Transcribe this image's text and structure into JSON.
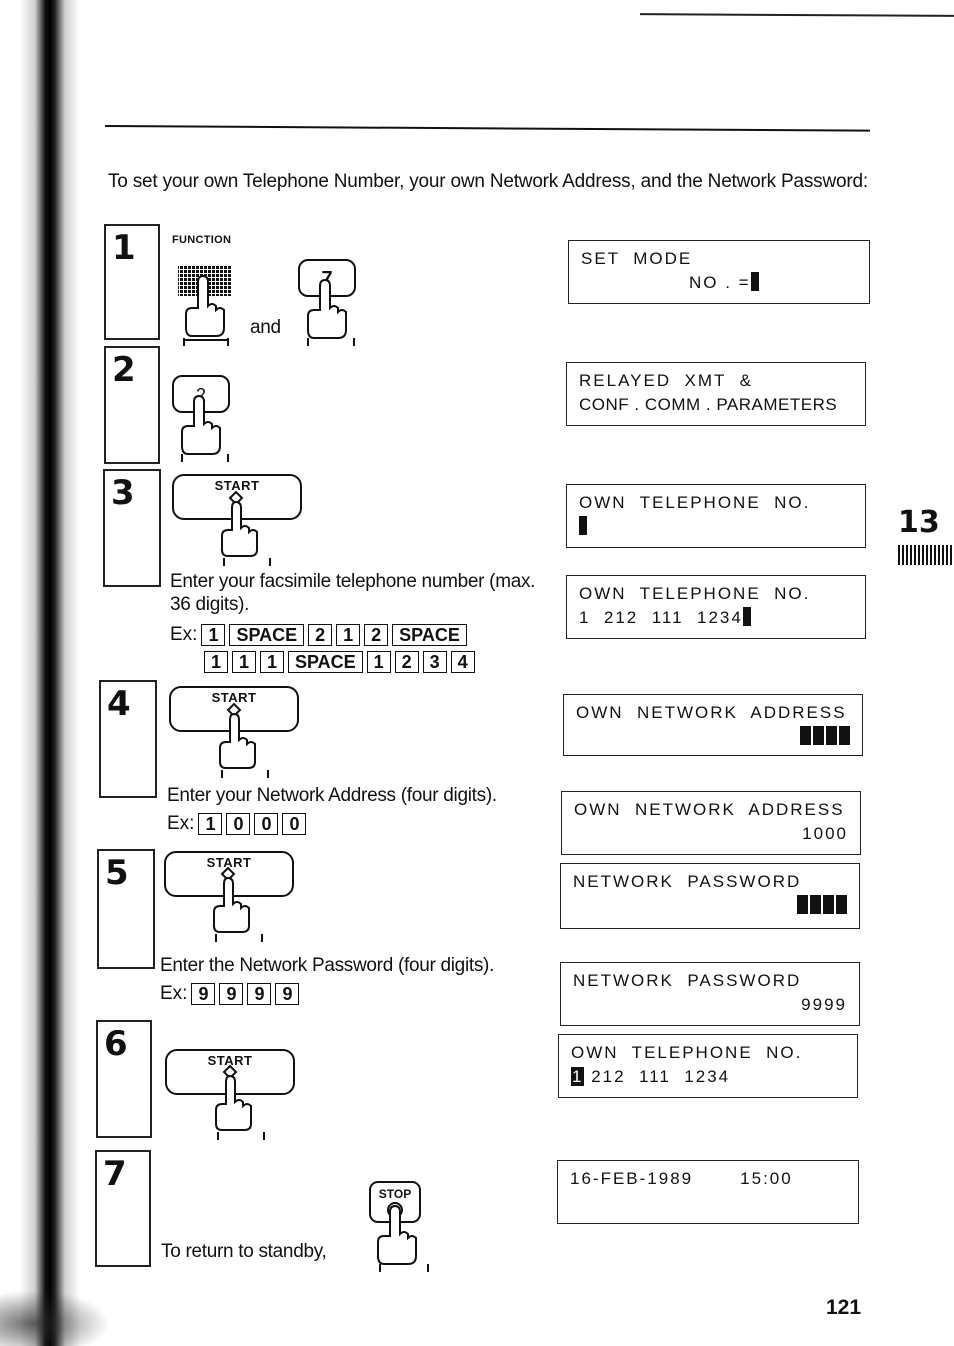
{
  "page": {
    "intro": "To set your own Telephone Number, your own Network Address, and the Network Password:",
    "chapter_tab": "13",
    "page_number": "121"
  },
  "steps": [
    {
      "number": "1",
      "key_label": "FUNCTION",
      "joiner": "and",
      "second_key": "7",
      "display": {
        "line1": "SET  MODE",
        "line2": "NO . ="
      }
    },
    {
      "number": "2",
      "key": "2",
      "display": {
        "line1": "RELAYED  XMT  &",
        "line2": "CONF . COMM . PARAMETERS"
      }
    },
    {
      "number": "3",
      "key": "START",
      "instruction": "Enter your facsimile telephone number (max. 36 digits).",
      "example_label": "Ex:",
      "example_keys_row1": [
        "1",
        "SPACE",
        "2",
        "1",
        "2",
        "SPACE"
      ],
      "example_keys_row2": [
        "1",
        "1",
        "1",
        "SPACE",
        "1",
        "2",
        "3",
        "4"
      ],
      "display_before": {
        "line1": "OWN  TELEPHONE  NO.",
        "line2": ""
      },
      "display_after": {
        "line1": "OWN  TELEPHONE  NO.",
        "line2": "1  212  111  1234"
      }
    },
    {
      "number": "4",
      "key": "START",
      "instruction": "Enter your Network Address (four digits).",
      "example_label": "Ex:",
      "example_keys": [
        "1",
        "0",
        "0",
        "0"
      ],
      "display_before": {
        "line1": "OWN  NETWORK  ADDRESS",
        "line2": ""
      },
      "display_after": {
        "line1": "OWN  NETWORK  ADDRESS",
        "line2": "1000"
      }
    },
    {
      "number": "5",
      "key": "START",
      "instruction": "Enter the Network Password (four digits).",
      "example_label": "Ex:",
      "example_keys": [
        "9",
        "9",
        "9",
        "9"
      ],
      "display_before": {
        "line1": "NETWORK  PASSWORD",
        "line2": ""
      },
      "display_after": {
        "line1": "NETWORK  PASSWORD",
        "line2": "9999"
      }
    },
    {
      "number": "6",
      "key": "START",
      "display": {
        "line1": "OWN  TELEPHONE  NO.",
        "line2_highlight": "1",
        "line2_rest": " 212  111  1234"
      }
    },
    {
      "number": "7",
      "instruction": "To return to standby,",
      "key": "STOP",
      "display": {
        "line1": "16-FEB-1989       15:00",
        "line2": ""
      }
    }
  ]
}
